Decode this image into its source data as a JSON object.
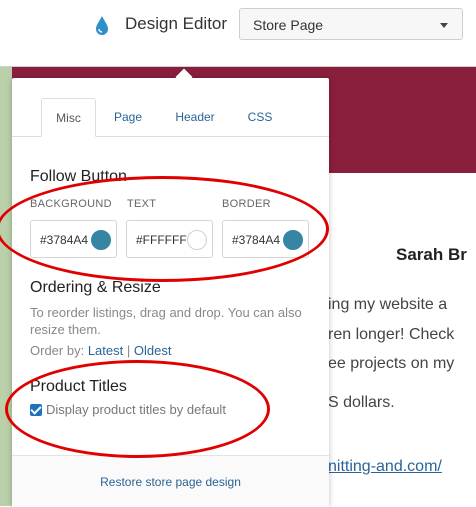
{
  "topbar": {
    "app_title": "Design Editor",
    "drop_icon": "water-drop-icon",
    "page_select": {
      "value": "Store Page"
    }
  },
  "preview": {
    "shop_name": "Sarah Br",
    "bio_lines": [
      "ing my website a",
      "ren longer! Check",
      "ee projects on my",
      "S dollars."
    ],
    "link_text": "nitting-and.com/",
    "colors": {
      "banner": "#8a1e3d",
      "left_strip": "#b9d0a8"
    }
  },
  "panel": {
    "tabs": [
      {
        "label": "Misc",
        "active": true
      },
      {
        "label": "Page",
        "active": false
      },
      {
        "label": "Header",
        "active": false
      },
      {
        "label": "CSS",
        "active": false
      }
    ],
    "follow_button": {
      "title": "Follow Button",
      "background": {
        "label": "BACKGROUND",
        "value": "#3784A4",
        "swatch": "#3784a4"
      },
      "text": {
        "label": "TEXT",
        "value": "#FFFFFF",
        "swatch": "#ffffff"
      },
      "border": {
        "label": "BORDER",
        "value": "#3784A4",
        "swatch": "#3784a4"
      }
    },
    "ordering": {
      "title": "Ordering & Resize",
      "description": "To reorder listings, drag and drop. You can also resize them.",
      "order_by_label": "Order by:",
      "latest": "Latest",
      "separator": "|",
      "oldest": "Oldest"
    },
    "product_titles": {
      "title": "Product Titles",
      "checkbox_label": "Display product titles by default",
      "checked": true
    },
    "restore_link": "Restore store page design"
  },
  "annotations": {
    "oval_color": "#e10000"
  }
}
